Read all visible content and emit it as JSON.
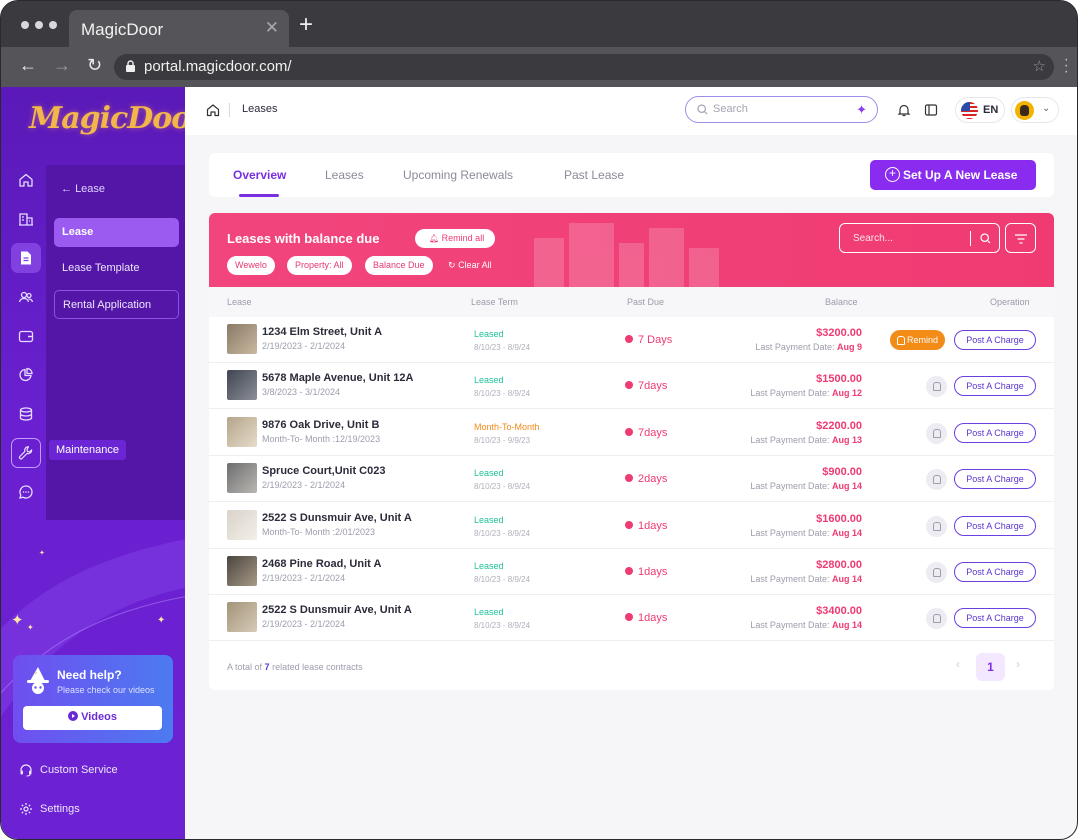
{
  "browser": {
    "tab_title": "MagicDoor",
    "tab_close": "✕",
    "new_tab": "+",
    "url": "portal.magicdoor.com/"
  },
  "sidebar": {
    "logo_text": "MagicDoor",
    "back_label": "Lease",
    "back_arrow": "←",
    "items": [
      {
        "label": "Lease"
      },
      {
        "label": "Lease Template"
      },
      {
        "label": "Rental Application"
      }
    ],
    "tooltip": "Maintenance",
    "help": {
      "title": "Need help?",
      "subtitle": "Please check our videos",
      "button": "Videos"
    },
    "footer": {
      "custom_service": "Custom Service",
      "settings": "Settings"
    }
  },
  "topbar": {
    "breadcrumb": "Leases",
    "search_placeholder": "Search",
    "language": "EN"
  },
  "tabs": [
    {
      "label": "Overview"
    },
    {
      "label": "Leases"
    },
    {
      "label": "Upcoming Renewals"
    },
    {
      "label": "Past Lease"
    }
  ],
  "new_lease_button": "Set Up A New Lease",
  "banner": {
    "title": "Leases with balance due",
    "remind_all": "Remind all",
    "chips": [
      "Wewelo",
      "Property: All",
      "Balance Due"
    ],
    "clear_all": "Clear All",
    "search_placeholder": "Search..."
  },
  "table": {
    "headers": [
      "Lease",
      "Lease Term",
      "Past Due",
      "Balance",
      "Operation"
    ],
    "balance_prefix": "Last Payment Date:",
    "remind_label": "Remind",
    "post_charge_label": "Post A Charge",
    "rows": [
      {
        "address": "1234 Elm Street, Unit A",
        "dates": "2/19/2023 - 2/1/2024",
        "status": "Leased",
        "term": "8/10/23 - 8/9/24",
        "past_due": "7 Days",
        "amount": "$3200.00",
        "last_payment": "Aug 9",
        "has_remind": true
      },
      {
        "address": "5678 Maple Avenue, Unit 12A",
        "dates": "3/8/2023 - 3/1/2024",
        "status": "Leased",
        "term": "8/10/23 - 8/9/24",
        "past_due": "7days",
        "amount": "$1500.00",
        "last_payment": "Aug 12",
        "has_remind": false
      },
      {
        "address": "9876 Oak Drive, Unit B",
        "dates": "Month-To- Month :12/19/2023",
        "status": "Month-To-Month",
        "term": "8/10/23 - 9/9/23",
        "past_due": "7days",
        "amount": "$2200.00",
        "last_payment": "Aug 13",
        "has_remind": false
      },
      {
        "address": "Spruce Court,Unit C023",
        "dates": "2/19/2023 - 2/1/2024",
        "status": "Leased",
        "term": "8/10/23 - 8/9/24",
        "past_due": "2days",
        "amount": "$900.00",
        "last_payment": "Aug 14",
        "has_remind": false
      },
      {
        "address": "2522 S Dunsmuir Ave, Unit A",
        "dates": "Month-To- Month :2/01/2023",
        "status": "Leased",
        "term": "8/10/23 - 8/9/24",
        "past_due": "1days",
        "amount": "$1600.00",
        "last_payment": "Aug 14",
        "has_remind": false
      },
      {
        "address": "2468 Pine Road, Unit A",
        "dates": "2/19/2023 - 2/1/2024",
        "status": "Leased",
        "term": "8/10/23 - 8/9/24",
        "past_due": "1days",
        "amount": "$2800.00",
        "last_payment": "Aug 14",
        "has_remind": false
      },
      {
        "address": "2522 S Dunsmuir Ave, Unit A",
        "dates": "2/19/2023 - 2/1/2024",
        "status": "Leased",
        "term": "8/10/23 - 8/9/24",
        "past_due": "1days",
        "amount": "$3400.00",
        "last_payment": "Aug 14",
        "has_remind": false
      }
    ],
    "footer_prefix": "A total of",
    "footer_count": "7",
    "footer_suffix": "related lease contracts",
    "current_page": "1",
    "prev_arrow": "‹",
    "next_arrow": "›"
  },
  "colors": {
    "sidebar": "#5a19b8",
    "accent": "#8a2cf0",
    "banner": "#f2457d",
    "leased": "#21c39a",
    "month_to_month": "#f38b17",
    "due": "#ee3b72"
  },
  "icons": {
    "nav": [
      "home-icon",
      "building-icon",
      "document-icon",
      "people-icon",
      "wallet-icon",
      "chart-icon",
      "database-icon",
      "wrench-icon",
      "chat-icon"
    ]
  }
}
